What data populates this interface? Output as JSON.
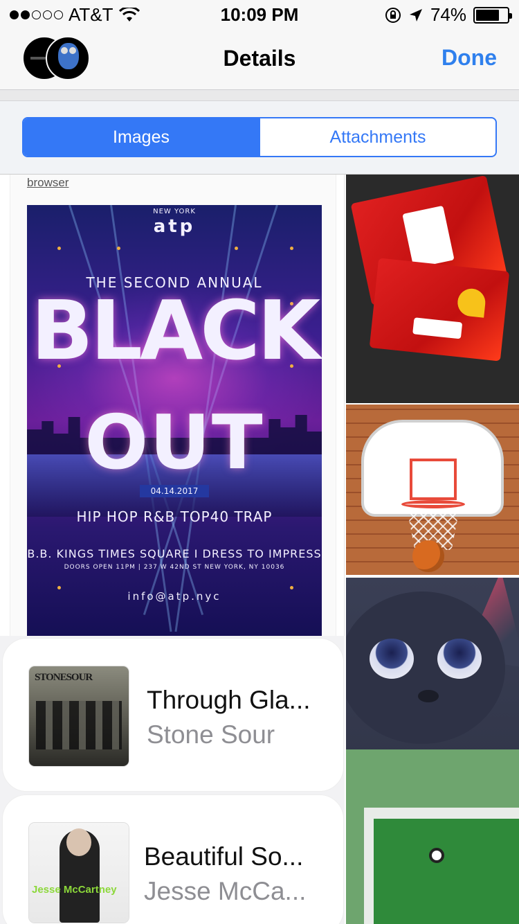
{
  "status_bar": {
    "carrier": "AT&T",
    "time": "10:09 PM",
    "battery_pct": "74%",
    "battery_level": 0.74,
    "signal_bars_filled": 2,
    "signal_bars_total": 5
  },
  "nav": {
    "title": "Details",
    "done_label": "Done"
  },
  "segments": {
    "images_label": "Images",
    "attachments_label": "Attachments",
    "selected": "Images"
  },
  "poster_card": {
    "link_text": "browser",
    "poster": {
      "city": "NEW YORK",
      "brand": "atp",
      "subtitle": "THE SECOND ANNUAL",
      "headline_1": "BLACK",
      "headline_2": "OUT",
      "date": "04.14.2017",
      "genres": "HIP HOP R&B TOP40 TRAP",
      "venue": "B.B. KINGS TIMES SQUARE I DRESS TO IMPRESS",
      "details": "DOORS OPEN 11PM | 237 W 42ND ST NEW YORK, NY 10036",
      "email": "info@atp.nyc"
    }
  },
  "music": [
    {
      "title": "Through Gla...",
      "artist": "Stone Sour",
      "album_art_text": "STONESOUR"
    },
    {
      "title": "Beautiful So...",
      "artist": "Jesse McCa...",
      "album_art_text": "Jesse McCartney"
    }
  ],
  "colors": {
    "accent": "#3478f6",
    "done": "#2f80ed",
    "secondary_text": "#8e8e93"
  }
}
